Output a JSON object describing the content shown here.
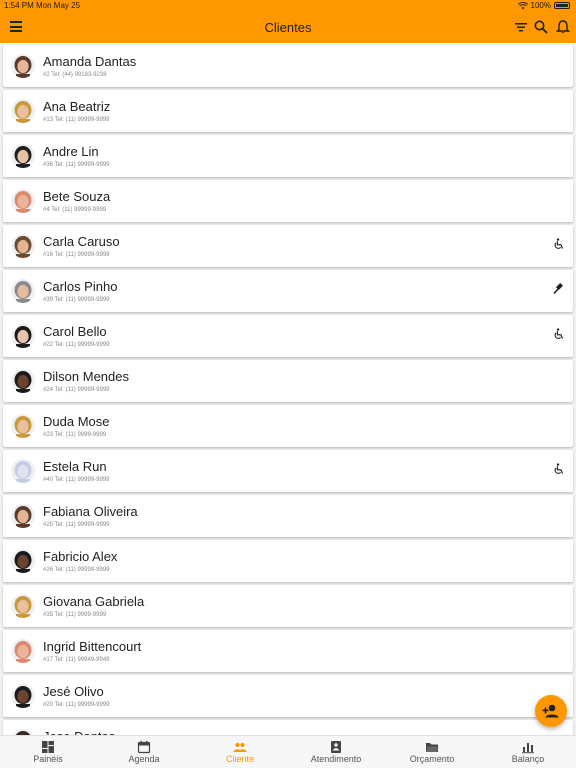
{
  "status_bar": {
    "time": "1:54 PM",
    "date": "Mon May 25",
    "battery": "100%"
  },
  "header": {
    "title": "Clientes"
  },
  "icons": {
    "menu": "menu-icon",
    "filter": "filter-icon",
    "search": "search-icon",
    "notifications": "bell-icon",
    "accessibility": "accessible-icon",
    "gavel": "gavel-icon",
    "add_person": "person-add-icon"
  },
  "colors": {
    "accent": "#ff9800",
    "background": "#f2f2f2",
    "card": "#ffffff"
  },
  "clients": [
    {
      "name": "Amanda Dantas",
      "details": "#2 Tel: (44) 99183-9238",
      "skin": "#e8b59a",
      "hair": "#5a3b2a",
      "flag": ""
    },
    {
      "name": "Ana Beatriz",
      "details": "#13 Tel: (11) 99999-9999",
      "skin": "#e9bfa0",
      "hair": "#c99a3b",
      "flag": ""
    },
    {
      "name": "Andre Lin",
      "details": "#36 Tel: (11) 99999-9999",
      "skin": "#e5c2a6",
      "hair": "#1f1f1f",
      "flag": ""
    },
    {
      "name": "Bete Souza",
      "details": "#4 Tel: (11) 99999-9999",
      "skin": "#eab39a",
      "hair": "#d98a70",
      "flag": ""
    },
    {
      "name": "Carla Caruso",
      "details": "#16 Tel: (11) 99999-9999",
      "skin": "#e2b394",
      "hair": "#6b4a2e",
      "flag": "accessible"
    },
    {
      "name": "Carlos Pinho",
      "details": "#39 Tel: (11) 99999-9999",
      "skin": "#e8b9a0",
      "hair": "#8a8a8a",
      "flag": "gavel"
    },
    {
      "name": "Carol Bello",
      "details": "#22 Tel: (11) 99999-9999",
      "skin": "#e6c3aa",
      "hair": "#1a1a1a",
      "flag": "accessible"
    },
    {
      "name": "Dilson Mendes",
      "details": "#24 Tel: (11) 99999-9999",
      "skin": "#6b4330",
      "hair": "#1a1a1a",
      "flag": ""
    },
    {
      "name": "Duda Mose",
      "details": "#23 Tel: (11) 9999-9999",
      "skin": "#e9bfa0",
      "hair": "#c99a3b",
      "flag": ""
    },
    {
      "name": "Estela Run",
      "details": "#40 Tel: (11) 99999-9999",
      "skin": "#dfe3f0",
      "hair": "#c5cbe0",
      "flag": "accessible"
    },
    {
      "name": "Fabiana Oliveira",
      "details": "#25 Tel: (11) 99999-9999",
      "skin": "#e2b394",
      "hair": "#5a3b2a",
      "flag": ""
    },
    {
      "name": "Fabricio Alex",
      "details": "#26 Tel: (11) 99999-9999",
      "skin": "#6b4330",
      "hair": "#1a1a1a",
      "flag": ""
    },
    {
      "name": "Giovana Gabriela",
      "details": "#35 Tel: (11) 9999-9999",
      "skin": "#e9bfa0",
      "hair": "#c99a3b",
      "flag": ""
    },
    {
      "name": "Ingrid Bittencourt",
      "details": "#17 Tel: (11) 99949-9949",
      "skin": "#eab39a",
      "hair": "#d98a70",
      "flag": ""
    },
    {
      "name": "Jesé Olivo",
      "details": "#20 Tel: (11) 99999-9999",
      "skin": "#6b4330",
      "hair": "#1a1a1a",
      "flag": ""
    },
    {
      "name": "Jose Dantas",
      "details": "",
      "skin": "#e8b59a",
      "hair": "#3a2a1a",
      "flag": ""
    }
  ],
  "bottom_nav": [
    {
      "label": "Painéis",
      "icon": "dashboard-icon",
      "active": false
    },
    {
      "label": "Agenda",
      "icon": "calendar-icon",
      "active": false
    },
    {
      "label": "Cliente",
      "icon": "people-icon",
      "active": true
    },
    {
      "label": "Atendimento",
      "icon": "badge-icon",
      "active": false
    },
    {
      "label": "Orçamento",
      "icon": "folder-icon",
      "active": false
    },
    {
      "label": "Balanço",
      "icon": "bar-chart-icon",
      "active": false
    }
  ]
}
